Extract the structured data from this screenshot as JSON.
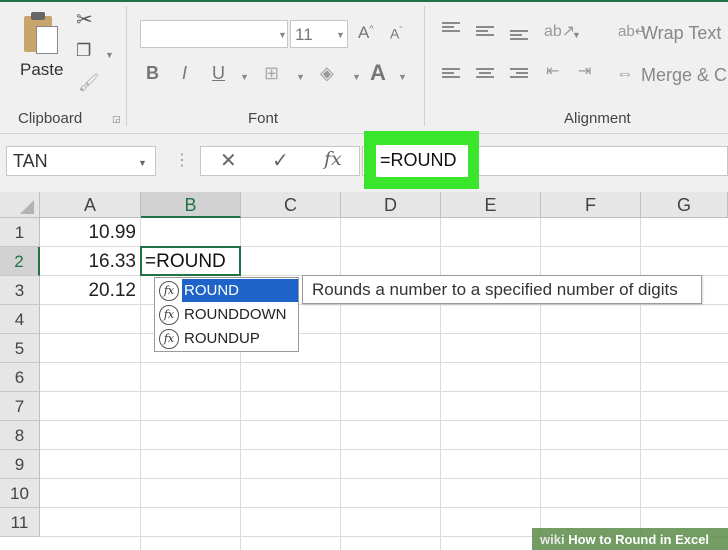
{
  "ribbon": {
    "clipboard": {
      "paste_label": "Paste",
      "group_label": "Clipboard",
      "icons": [
        "cut-icon",
        "copy-icon",
        "format-painter-icon"
      ]
    },
    "font": {
      "font_name": "",
      "font_size": "11",
      "bold": "B",
      "italic": "I",
      "underline": "U",
      "font_color_letter": "A",
      "grow": "A",
      "shrink": "A",
      "group_label": "Font"
    },
    "alignment": {
      "wrap_text": "Wrap Text",
      "merge_center": "Merge & C",
      "group_label": "Alignment"
    }
  },
  "formula_bar": {
    "name_box": "TAN",
    "cancel_symbol": "✕",
    "enter_symbol": "✓",
    "fx_symbol": "fx",
    "formula": "=ROUND"
  },
  "grid": {
    "columns": [
      "A",
      "B",
      "C",
      "D",
      "E",
      "F",
      "G"
    ],
    "rows": [
      "1",
      "2",
      "3",
      "4",
      "5",
      "6",
      "7",
      "8",
      "9",
      "10",
      "11"
    ],
    "cells": {
      "A1": "10.99",
      "A2": "16.33",
      "A3": "20.12"
    },
    "active_cell_text": "=ROUND"
  },
  "autocomplete": {
    "items": [
      "ROUND",
      "ROUNDDOWN",
      "ROUNDUP"
    ],
    "selected": "ROUND",
    "fx_glyph": "fx",
    "tooltip": "Rounds a number to a specified number of digits"
  },
  "watermark": {
    "wiki": "wiki",
    "text": "How to Round in Excel"
  },
  "colors": {
    "accent": "#217346",
    "highlight": "#39e62b",
    "selection": "#1e64c8"
  }
}
